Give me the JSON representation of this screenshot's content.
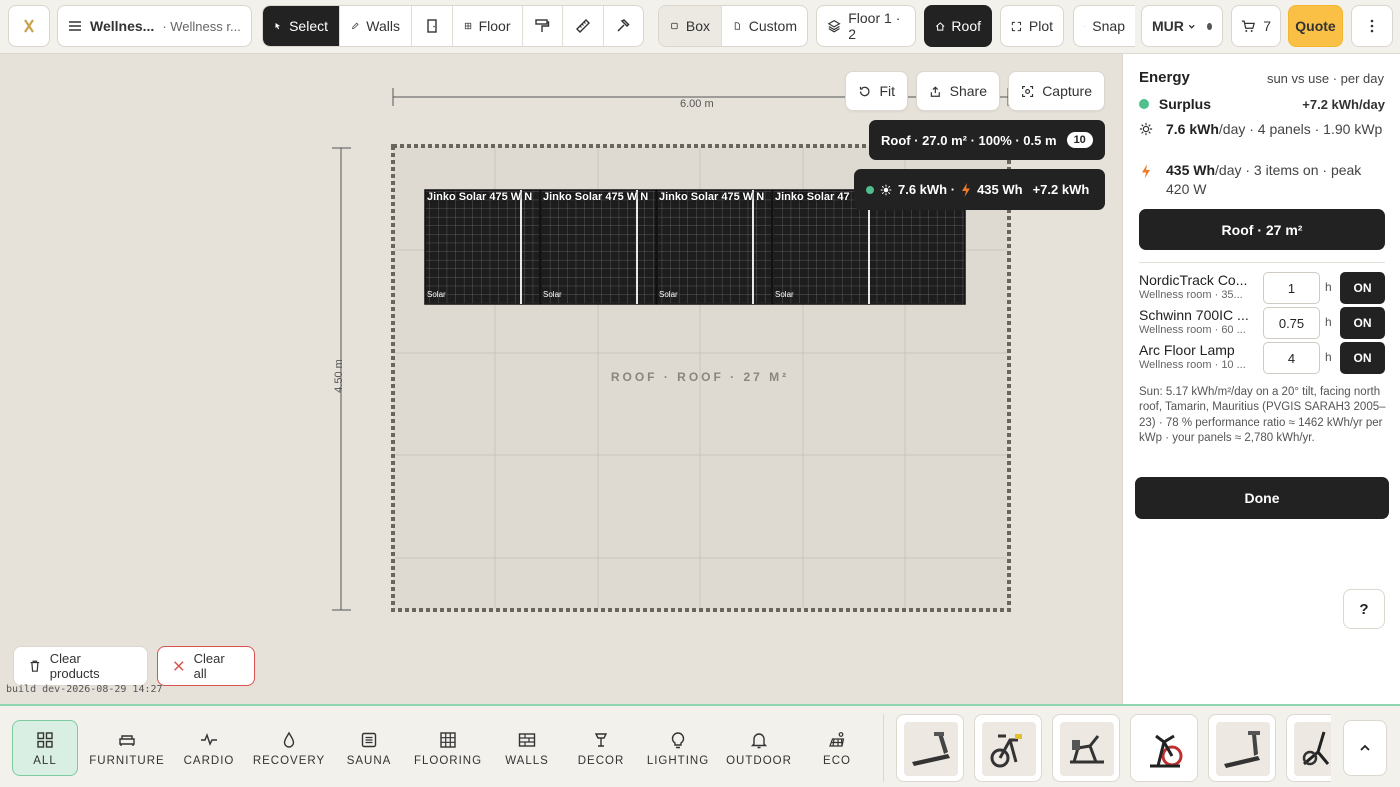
{
  "header": {
    "project_title": "Wellnes...",
    "project_subtitle": "· Wellness r...",
    "tools": {
      "select": "Select",
      "walls": "Walls",
      "floor": "Floor",
      "box": "Box",
      "custom": "Custom",
      "floor_level": "Floor 1 · 2",
      "roof": "Roof",
      "plot": "Plot",
      "snap": "Snap",
      "currency": "MUR",
      "cart_count": "7",
      "quote": "Quote"
    }
  },
  "canvas": {
    "buttons": {
      "fit": "Fit",
      "share": "Share",
      "capture": "Capture"
    },
    "width_dim": "6.00 m",
    "height_dim": "4.50 m",
    "roof_info": "Roof · 27.0 m² · 100% · 0.5 m",
    "roof_badge": "10",
    "energy_tip": {
      "solar": "7.6 kWh ·",
      "use": "435 Wh",
      "net": "+7.2 kWh"
    },
    "roof_label": "ROOF · ROOF · 27 M²",
    "panels": [
      {
        "name": "Jinko Solar 475 W N",
        "mini": "Solar"
      },
      {
        "name": "Jinko Solar 475 W N",
        "mini": "Solar"
      },
      {
        "name": "Jinko Solar 475 W N",
        "mini": "Solar"
      },
      {
        "name": "Jinko Solar 47",
        "mini": "Solar"
      }
    ],
    "clear_products": "Clear products",
    "clear_all": "Clear all",
    "build": "build dev-2026-08-29 14:27"
  },
  "energy": {
    "title": "Energy",
    "subtitle": "sun vs use · per day",
    "status": "Surplus",
    "status_value": "+7.2 kWh/day",
    "gen_value": "7.6 kWh",
    "gen_rest": "/day · 4 panels · 1.90 kWp",
    "use_value": "435 Wh",
    "use_rest": "/day · 3 items on · peak 420 W",
    "roof_button": "Roof · 27 m²",
    "items": [
      {
        "name": "NordicTrack Co...",
        "sub": "Wellness room · 35...",
        "hours": "1",
        "h": "h",
        "state": "ON"
      },
      {
        "name": "Schwinn 700IC ...",
        "sub": "Wellness room · 60 ...",
        "hours": "0.75",
        "h": "h",
        "state": "ON"
      },
      {
        "name": "Arc Floor Lamp",
        "sub": "Wellness room · 10 ...",
        "hours": "4",
        "h": "h",
        "state": "ON"
      }
    ],
    "sun_note": "Sun: 5.17 kWh/m²/day on a 20° tilt, facing north roof, Tamarin, Mauritius (PVGIS SARAH3 2005–23) · 78 % performance ratio ≈ 1462 kWh/yr per kWp · your panels ≈ 2,780 kWh/yr.",
    "done": "Done",
    "help": "?"
  },
  "categories": {
    "all": "ALL",
    "furniture": "FURNITURE",
    "cardio": "CARDIO",
    "recovery": "RECOVERY",
    "sauna": "SAUNA",
    "flooring": "FLOORING",
    "walls": "WALLS",
    "decor": "DECOR",
    "lighting": "LIGHTING",
    "outdoor": "OUTDOOR",
    "eco": "ECO"
  },
  "colors": {
    "accent_dark": "#222222",
    "quote_yellow": "#f9c045",
    "surplus_green": "#4fc08d",
    "bolt_orange": "#f07a2d",
    "clear_all_red": "#d9534f"
  }
}
